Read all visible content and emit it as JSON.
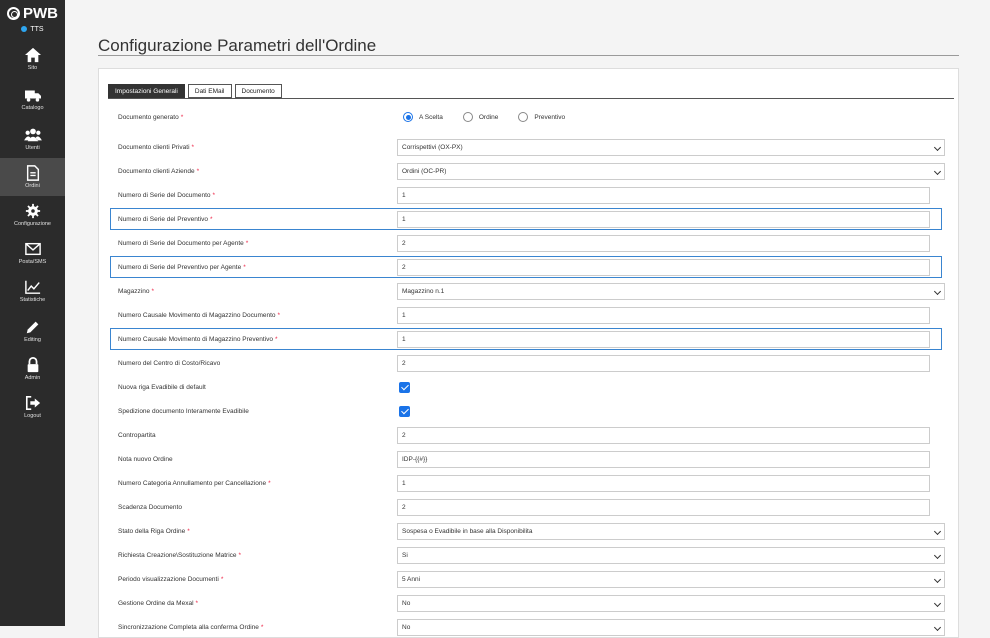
{
  "app": {
    "logo": "PWB",
    "status": "TTS"
  },
  "sidebar": [
    {
      "label": "Sito",
      "icon": "home-icon"
    },
    {
      "label": "Catalogo",
      "icon": "truck-icon"
    },
    {
      "label": "Utenti",
      "icon": "users-icon"
    },
    {
      "label": "Ordini",
      "icon": "document-icon",
      "active": true
    },
    {
      "label": "Configurazione",
      "icon": "gear-icon"
    },
    {
      "label": "Posta/SMS",
      "icon": "envelope-icon"
    },
    {
      "label": "Statistiche",
      "icon": "chart-icon"
    },
    {
      "label": "Editing",
      "icon": "pencil-icon"
    },
    {
      "label": "Admin",
      "icon": "lock-icon"
    },
    {
      "label": "Logout",
      "icon": "logout-icon"
    }
  ],
  "page": {
    "title": "Configurazione Parametri dell'Ordine"
  },
  "tabs": [
    "Impostazioni Generali",
    "Dati EMail",
    "Documento"
  ],
  "form": {
    "documento_generato": {
      "label": "Documento generato",
      "options": [
        "A Scelta",
        "Ordine",
        "Preventivo"
      ],
      "selected": "A Scelta"
    },
    "rows": [
      {
        "label": "Documento clienti Privati",
        "required": "*",
        "value": "Corrispettivi (OX-PX)",
        "type": "select"
      },
      {
        "label": "Documento clienti Aziende",
        "required": "*",
        "value": "Ordini (OC-PR)",
        "type": "select"
      },
      {
        "label": "Numero di Serie del Documento",
        "required": "*",
        "value": "1",
        "type": "input"
      },
      {
        "label": "Numero di Serie del Preventivo",
        "required": "*",
        "value": "1",
        "type": "input",
        "highlight": true
      },
      {
        "label": "Numero di Serie del Documento per Agente",
        "required": "*",
        "value": "2",
        "type": "input"
      },
      {
        "label": "Numero di Serie del Preventivo per Agente",
        "required": "*",
        "value": "2",
        "type": "input",
        "highlight": true
      },
      {
        "label": "Magazzino",
        "required": "*",
        "value": "Magazzino n.1",
        "type": "select"
      },
      {
        "label": "Numero Causale Movimento di Magazzino Documento",
        "required": "*",
        "value": "1",
        "type": "input"
      },
      {
        "label": "Numero Causale Movimento di Magazzino Preventivo",
        "required": "*",
        "value": "1",
        "type": "input",
        "highlight": true
      },
      {
        "label": "Numero del Centro di Costo/Ricavo",
        "required": "",
        "value": "2",
        "type": "input"
      },
      {
        "label": "Nuova riga Evadibile di default",
        "required": "",
        "checked": true,
        "type": "checkbox"
      },
      {
        "label": "Spedizione documento Interamente Evadibile",
        "required": "",
        "checked": true,
        "type": "checkbox"
      },
      {
        "label": "Contropartita",
        "required": "",
        "value": "2",
        "type": "input"
      },
      {
        "label": "Nota nuovo Ordine",
        "required": "",
        "value": "IDP-{{#}}",
        "type": "input"
      },
      {
        "label": "Numero Categoria Annullamento per Cancellazione",
        "required": "*",
        "value": "1",
        "type": "input"
      },
      {
        "label": "Scadenza Documento",
        "required": "",
        "value": "2",
        "type": "input"
      },
      {
        "label": "Stato della Riga Ordine",
        "required": "*",
        "value": "Sospesa o Evadibile in base alla Disponibilita",
        "type": "select"
      },
      {
        "label": "Richiesta Creazione\\Sostituzione Matrice",
        "required": "*",
        "value": "Si",
        "type": "select"
      },
      {
        "label": "Periodo visualizzazione Documenti",
        "required": "*",
        "value": "5 Anni",
        "type": "select"
      },
      {
        "label": "Gestione Ordine da Mexal",
        "required": "*",
        "value": "No",
        "type": "select"
      },
      {
        "label": "Sincronizzazione Completa alla conferma Ordine",
        "required": "*",
        "value": "No",
        "type": "select"
      }
    ]
  },
  "colors": {
    "accent": "#1a73e8",
    "highlight": "#3a85d0",
    "sidebar": "#2b2b2b"
  }
}
